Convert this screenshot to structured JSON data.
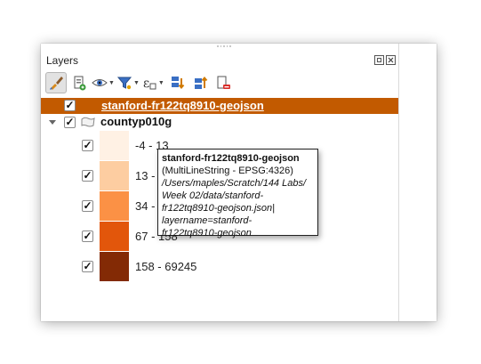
{
  "panel": {
    "title": "Layers"
  },
  "window_buttons": [
    {
      "name": "float-panel-button",
      "icon": "float-icon"
    },
    {
      "name": "close-panel-button",
      "icon": "close-icon"
    }
  ],
  "toolbar": {
    "items": [
      {
        "name": "open-layer-styling-button",
        "icon": "paintbrush-icon",
        "active": true
      },
      {
        "name": "add-group-button",
        "icon": "add-group-icon"
      },
      {
        "name": "manage-visibility-button",
        "icon": "eye-icon",
        "has_menu": true
      },
      {
        "name": "filter-legend-button",
        "icon": "filter-icon",
        "has_menu": true
      },
      {
        "name": "filter-expression-button",
        "icon": "epsilon-icon",
        "has_menu": true
      },
      {
        "name": "expand-all-button",
        "icon": "expand-all-icon"
      },
      {
        "name": "collapse-all-button",
        "icon": "collapse-all-icon"
      },
      {
        "name": "remove-layer-button",
        "icon": "remove-layer-icon"
      }
    ]
  },
  "layers": [
    {
      "name": "stanford-fr122tq8910-geojson",
      "checked": "✓",
      "selected": true
    },
    {
      "name": "countyp010g",
      "checked": "✓",
      "expanded": true
    }
  ],
  "legend": [
    {
      "label": "-4 - 13",
      "checked": "✓",
      "color": "#fff1e4"
    },
    {
      "label": "13 - 34",
      "checked": "✓",
      "color": "#fdcda1"
    },
    {
      "label": "34 - 67",
      "checked": "✓",
      "color": "#fb9145"
    },
    {
      "label": "67 - 158",
      "checked": "✓",
      "color": "#e2560b"
    },
    {
      "label": "158 - 69245",
      "checked": "✓",
      "color": "#832a05"
    }
  ],
  "tooltip": {
    "title": "stanford-fr122tq8910-geojson",
    "subtitle": "(MultiLineString - EPSG:4326)",
    "path_lines": [
      "/Users/maples/Scratch/144 Labs/",
      "Week 02/data/stanford-",
      "fr122tq8910-geojson.json|",
      "layername=stanford-",
      "fr122tq8910-geojson"
    ]
  },
  "colors": {
    "selection": "#c25a00",
    "checkmark": "#111111"
  }
}
